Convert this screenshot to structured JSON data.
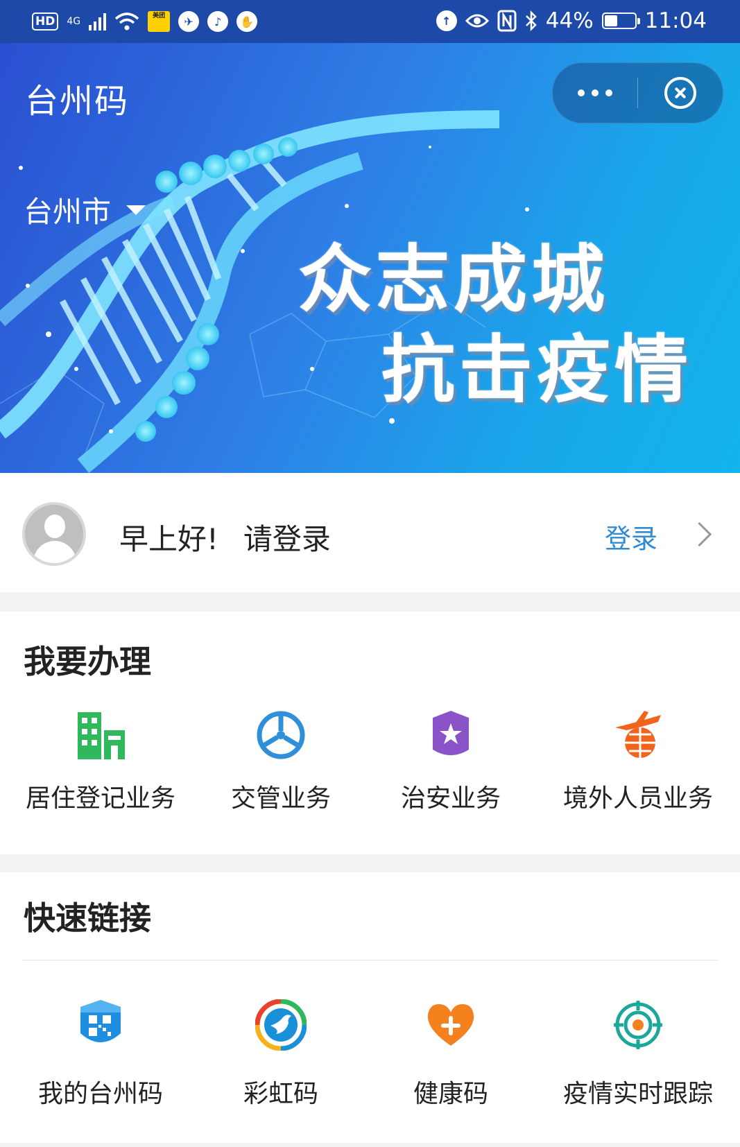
{
  "status_bar": {
    "hd": "HD",
    "network": "4G",
    "meituan": "美团",
    "battery_percent": "44%",
    "battery_level": 0.44,
    "time": "11:04"
  },
  "header": {
    "title": "台州码",
    "more_icon": "more-dots-icon",
    "close_icon": "close-circle-icon"
  },
  "banner": {
    "city": "台州市",
    "slogan_line1": "众志成城",
    "slogan_line2": "抗击疫情"
  },
  "login": {
    "greeting": "早上好!",
    "prompt": "请登录",
    "action": "登录"
  },
  "services": {
    "title": "我要办理",
    "items": [
      {
        "label": "居住登记业务",
        "icon": "building-icon",
        "color": "#2fb85c"
      },
      {
        "label": "交管业务",
        "icon": "steering-wheel-icon",
        "color": "#2f8fd8"
      },
      {
        "label": "治安业务",
        "icon": "police-shield-icon",
        "color": "#8a54c8"
      },
      {
        "label": "境外人员业务",
        "icon": "plane-globe-icon",
        "color": "#f0641e"
      }
    ]
  },
  "quick_links": {
    "title": "快速链接",
    "items": [
      {
        "label": "我的台州码",
        "icon": "qr-shield-icon",
        "color": "#1e8ee0"
      },
      {
        "label": "彩虹码",
        "icon": "rainbow-bird-icon",
        "color": "#1a90d8"
      },
      {
        "label": "健康码",
        "icon": "heart-plus-icon",
        "color": "#f5801e"
      },
      {
        "label": "疫情实时跟踪",
        "icon": "target-tracking-icon",
        "color": "#1aa89a"
      }
    ]
  }
}
